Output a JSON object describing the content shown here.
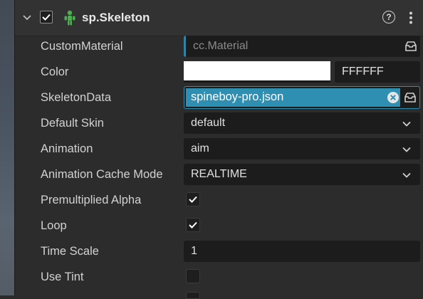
{
  "component": {
    "title": "sp.Skeleton",
    "enabled": true,
    "icons": {
      "collapse": "chevron-down-icon",
      "component": "skeleton-figure-icon",
      "help": "help-circle-icon",
      "menu": "more-vertical-icon"
    },
    "help_glyph": "?"
  },
  "properties": {
    "custom_material": {
      "label": "CustomMaterial",
      "placeholder": "cc.Material"
    },
    "color": {
      "label": "Color",
      "swatch": "#FFFFFF",
      "hex": "FFFFFF"
    },
    "skeleton_data": {
      "label": "SkeletonData",
      "value": "spineboy-pro.json"
    },
    "default_skin": {
      "label": "Default Skin",
      "value": "default"
    },
    "animation": {
      "label": "Animation",
      "value": "aim"
    },
    "animation_cache_mode": {
      "label": "Animation Cache Mode",
      "value": "REALTIME"
    },
    "premultiplied_alpha": {
      "label": "Premultiplied Alpha",
      "checked": true
    },
    "loop": {
      "label": "Loop",
      "checked": true
    },
    "time_scale": {
      "label": "Time Scale",
      "value": "1"
    },
    "use_tint": {
      "label": "Use Tint",
      "checked": false
    }
  },
  "colors": {
    "accent": "#2F8FB3",
    "component_icon": "#4CAF50",
    "panel_bg": "#2C2C2C",
    "field_bg": "#1C1C1C"
  }
}
